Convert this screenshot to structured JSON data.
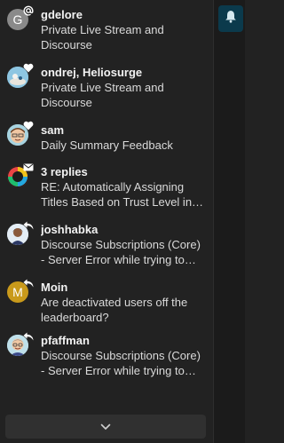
{
  "notifications": [
    {
      "user": "gdelore",
      "text": "Private Live Stream and Discourse",
      "badge": "at-icon",
      "avatar_letter": "G",
      "avatar_color": "#8a8a8a"
    },
    {
      "user": "ondrej, Heliosurge",
      "text": "Private Live Stream and Discourse",
      "badge": "heart-icon"
    },
    {
      "user": "sam",
      "text": "Daily Summary Feedback",
      "badge": "heart-icon"
    },
    {
      "user": "3 replies",
      "text": "RE: Automatically Assigning Titles Based on Trust Level in…",
      "badge": "envelope-icon"
    },
    {
      "user": "joshhabka",
      "text": "Discourse Subscriptions (Core) - Server Error while trying to…",
      "badge": "reply-icon"
    },
    {
      "user": "Moin",
      "text": "Are deactivated users off the leaderboard?",
      "badge": "reply-icon",
      "avatar_letter": "M",
      "avatar_color": "#c99a1b"
    },
    {
      "user": "pfaffman",
      "text": "Discourse Subscriptions (Core) - Server Error while trying to…",
      "badge": "reply-icon"
    }
  ],
  "footer": {
    "more_icon": "chevron-down-icon"
  },
  "rail": {
    "active_icon": "bell-icon",
    "accent": "#0b3a4c"
  }
}
